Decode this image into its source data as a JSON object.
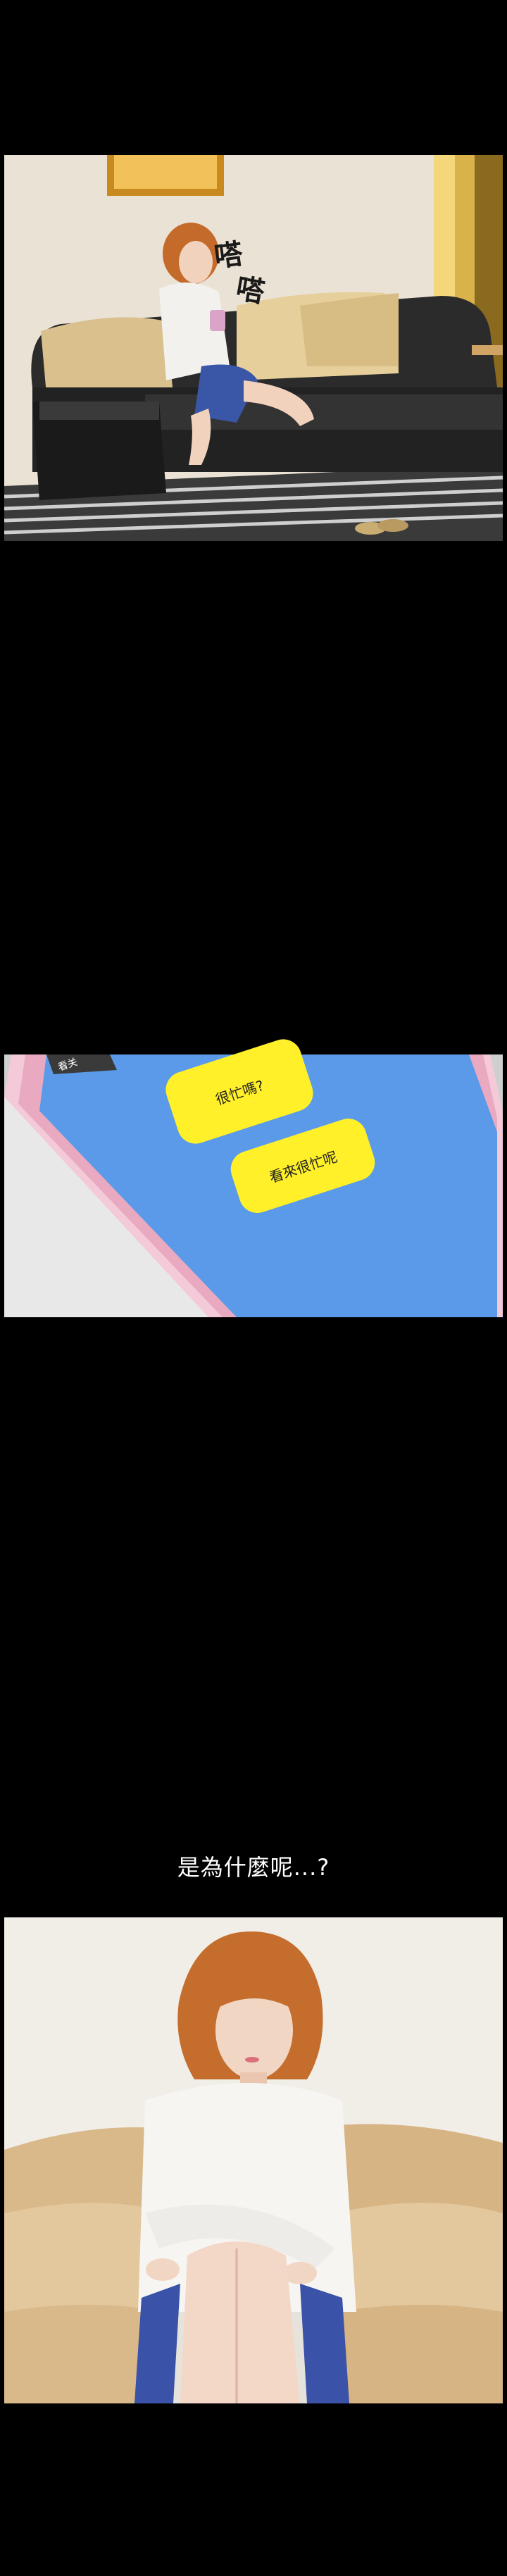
{
  "panel1": {
    "sfx_1": "嗒",
    "sfx_2": "嗒"
  },
  "panel2": {
    "phone_header": "看关",
    "message_1": "很忙嗎?",
    "message_2": "看來很忙呢"
  },
  "caption": {
    "text": "是為什麼呢...?"
  },
  "colors": {
    "background": "#000000",
    "bubble": "#fff02a",
    "phone_screen": "#5b9ae8"
  }
}
